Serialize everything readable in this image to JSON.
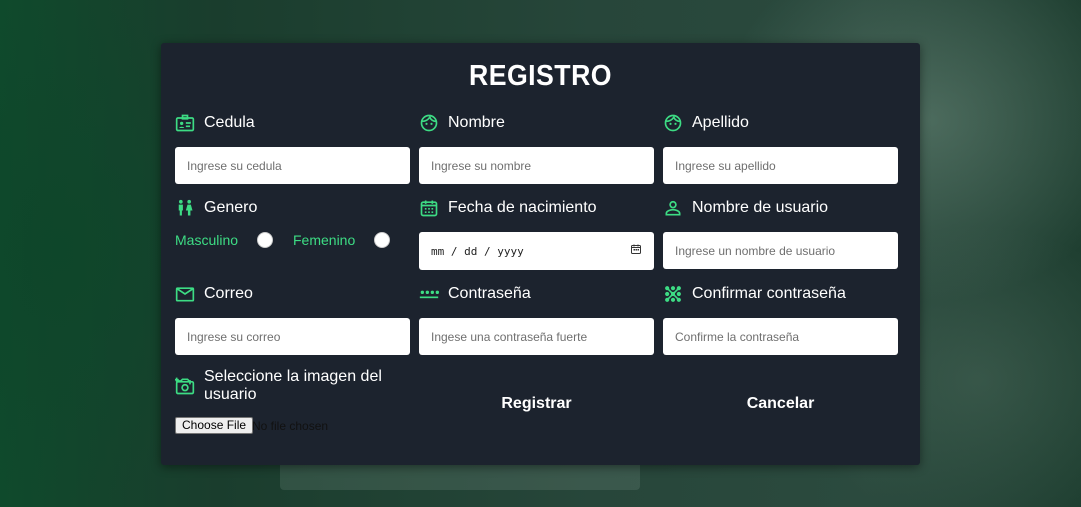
{
  "form": {
    "title": "REGISTRO",
    "cedula": {
      "label": "Cedula",
      "placeholder": "Ingrese su cedula",
      "icon": "id-card-icon"
    },
    "nombre": {
      "label": "Nombre",
      "placeholder": "Ingrese su nombre",
      "icon": "face-icon"
    },
    "apellido": {
      "label": "Apellido",
      "placeholder": "Ingrese su apellido",
      "icon": "face-icon"
    },
    "genero": {
      "label": "Genero",
      "icon": "people-icon",
      "options": [
        "Masculino",
        "Femenino"
      ]
    },
    "fecha": {
      "label": "Fecha de nacimiento",
      "value": "mm / dd / yyyy",
      "icon": "calendar-icon"
    },
    "usuario": {
      "label": "Nombre de usuario",
      "placeholder": "Ingrese un nombre de usuario",
      "icon": "person-icon"
    },
    "correo": {
      "label": "Correo",
      "placeholder": "Ingrese su correo",
      "icon": "mail-icon"
    },
    "contrasena": {
      "label": "Contraseña",
      "placeholder": "Ingese una contraseña fuerte",
      "icon": "password-dots-icon"
    },
    "confirmar": {
      "label": "Confirmar contraseña",
      "placeholder": "Confirme la contraseña",
      "icon": "pattern-icon"
    },
    "imagen": {
      "label": "Seleccione la imagen del usuario",
      "icon": "add-photo-icon",
      "button": "Choose File",
      "status": "No file chosen"
    },
    "actions": {
      "registrar": "Registrar",
      "cancelar": "Cancelar"
    }
  },
  "colors": {
    "accent": "#3ddc84",
    "card": "#1c232e"
  }
}
